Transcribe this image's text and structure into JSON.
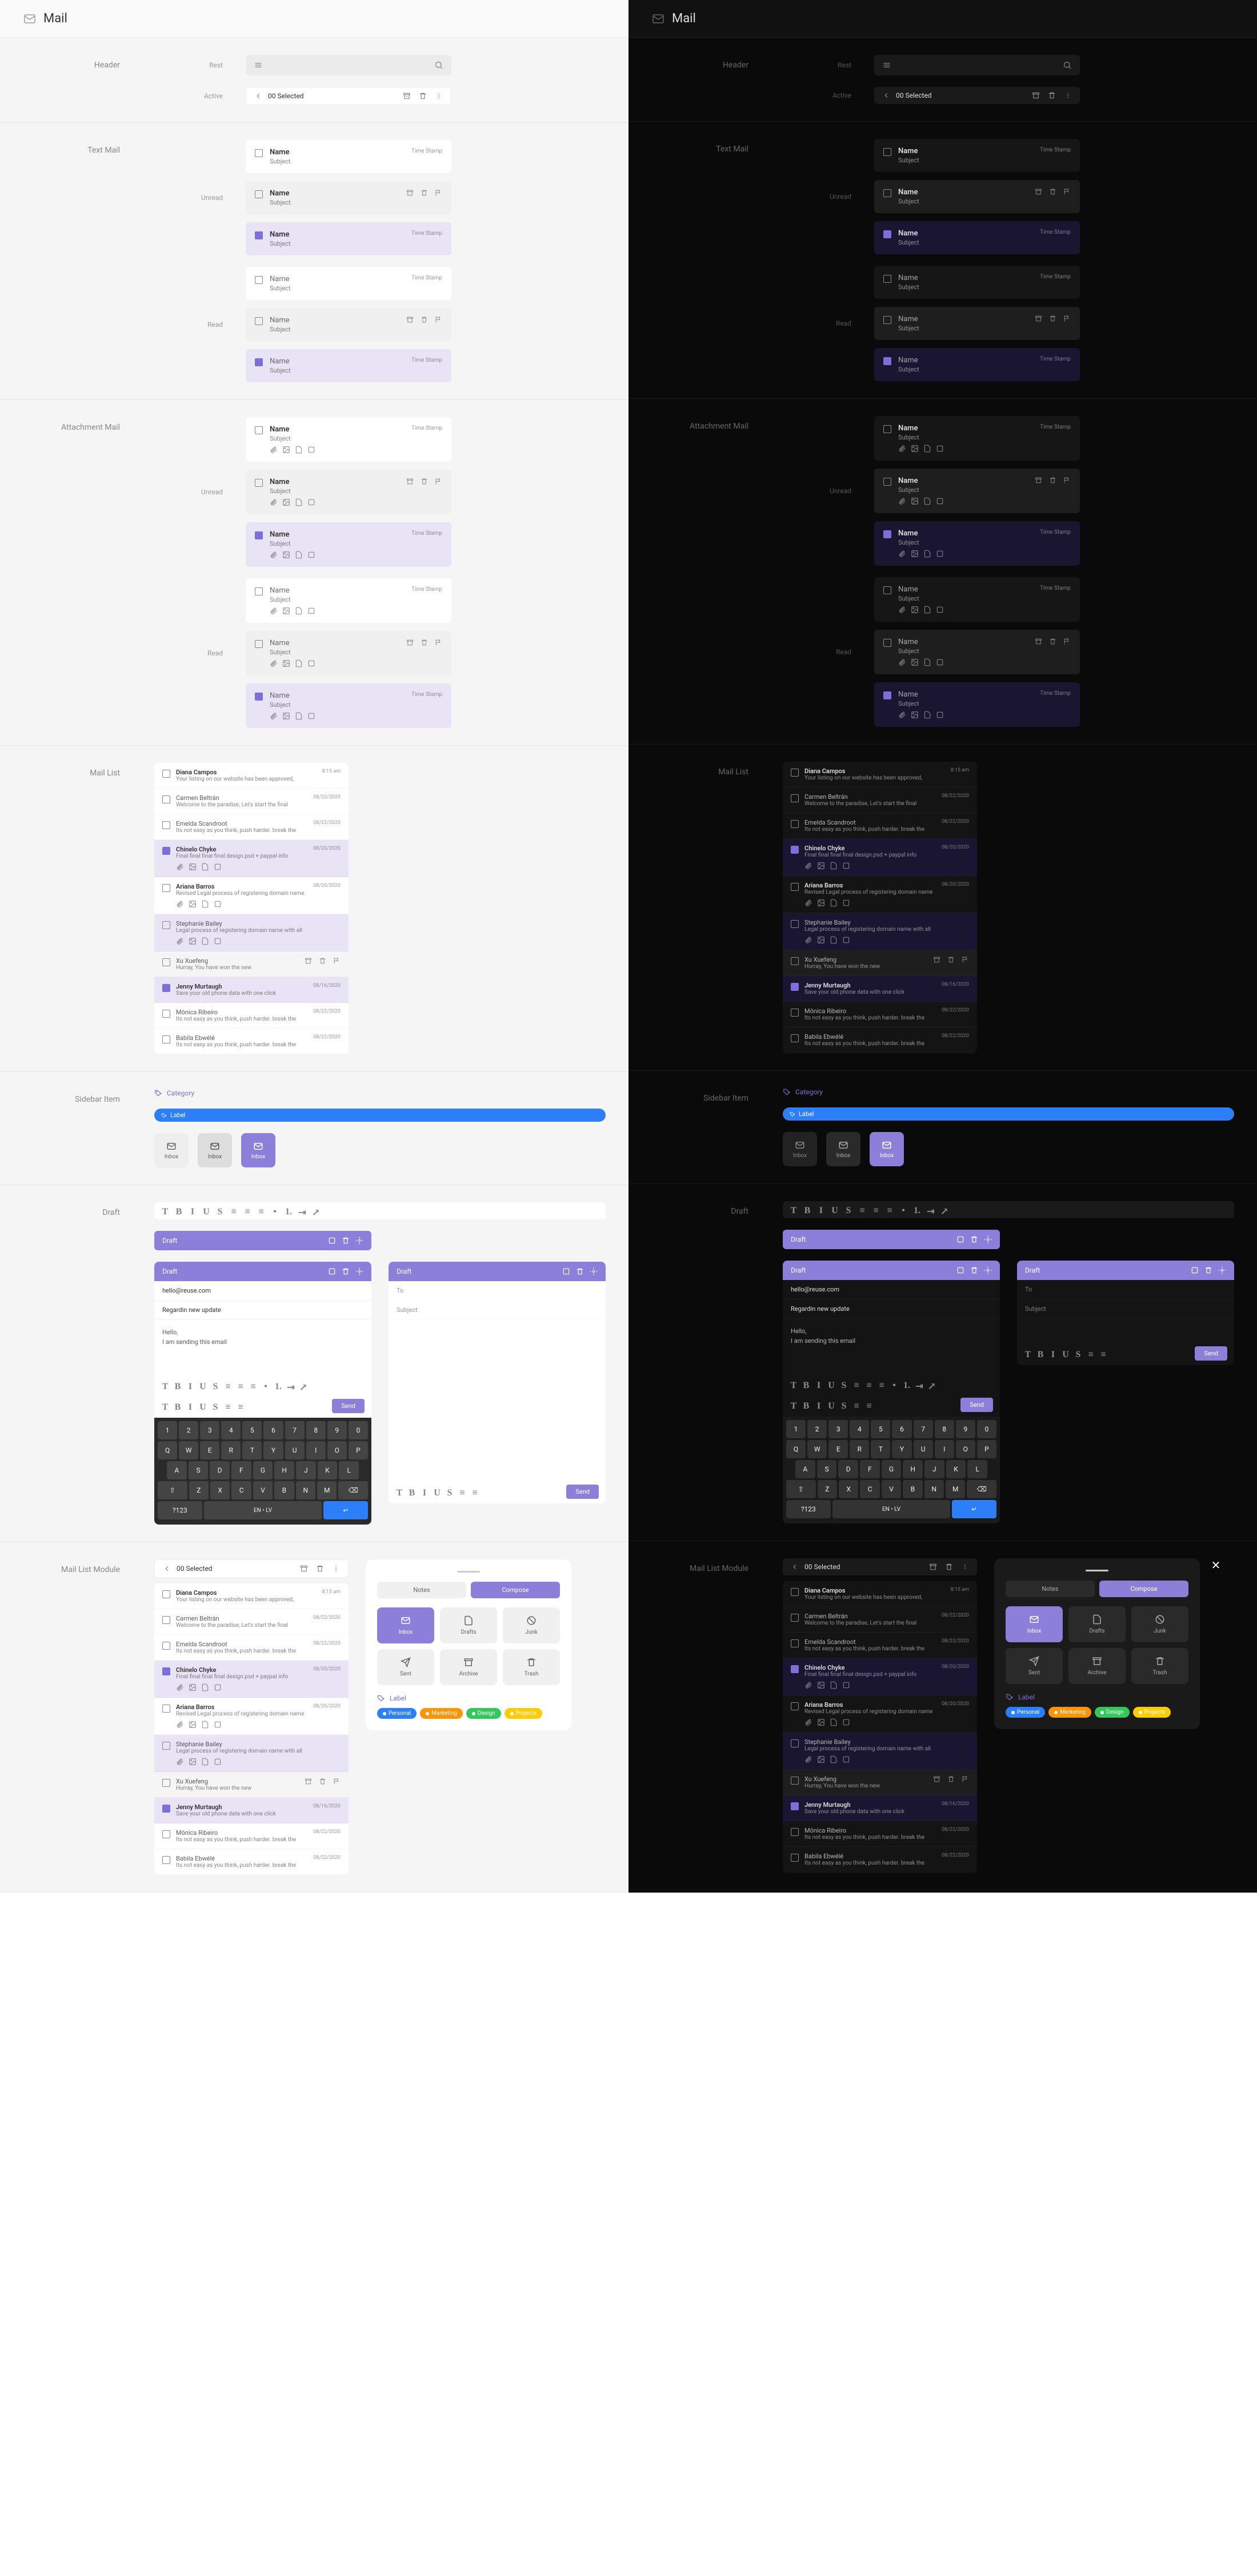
{
  "app_title": "Mail",
  "sections": {
    "header": "Header",
    "text_mail": "Text Mail",
    "attachment_mail": "Attachment Mail",
    "mail_list": "Mail List",
    "sidebar_item": "Sidebar Item",
    "draft": "Draft",
    "mail_list_module": "Mail List Module"
  },
  "states": {
    "rest": "Rest",
    "active": "Active",
    "unread": "Unread",
    "read": "Read"
  },
  "header_bar": {
    "selected_count": "00 Selected"
  },
  "placeholder": {
    "name": "Name",
    "subject": "Subject",
    "timestamp": "Time Stamp"
  },
  "mail_list_data": [
    {
      "name": "Diana Campos",
      "subject": "Your listing on our website has been approved,",
      "time": "8:15 am",
      "unread": true
    },
    {
      "name": "Carmen Beltrán",
      "subject": "Welcome to the paradise, Let's start the final",
      "time": "08/22/2020",
      "unread": false
    },
    {
      "name": "Emelda Scandroot",
      "subject": "Its not easy as you think, push harder. break the",
      "time": "08/22/2020",
      "unread": false
    },
    {
      "name": "Chinelo Chyke",
      "subject": "Final final final final design.psd + paypal info",
      "time": "08/20/2020",
      "unread": true,
      "selected": true,
      "attachments": true
    },
    {
      "name": "Ariana Barros",
      "subject": "Revised Legal process of registering domain name",
      "time": "08/20/2020",
      "unread": true,
      "attachments": true
    },
    {
      "name": "Stephanie Bailey",
      "subject": "Legal process of registering domain name with all",
      "time": "",
      "unread": false,
      "selected_light": true,
      "attachments": true
    },
    {
      "name": "Xu Xuefeng",
      "subject": "Hurray, You have won the new",
      "time": "",
      "unread": false,
      "hover": true,
      "actions": true
    },
    {
      "name": "Jenny Murtaugh",
      "subject": "Save your old phone data with one click",
      "time": "08/16/2020",
      "unread": true,
      "selected": true
    },
    {
      "name": "Mônica Ribeiro",
      "subject": "Its not easy as you think, push harder. break the",
      "time": "08/22/2020",
      "unread": false
    },
    {
      "name": "Babila Ebwélé",
      "subject": "Its not easy as you think, push harder. break the",
      "time": "08/22/2020",
      "unread": false
    }
  ],
  "sidebar": {
    "category": "Category",
    "label": "Label",
    "inbox": "Inbox"
  },
  "draft": {
    "title": "Draft",
    "to_field": "hello@reuse.com",
    "to_placeholder": "To",
    "subject_field": "Regardin new update",
    "subject_placeholder": "Subject",
    "body_greeting": "Hello,",
    "body_line": "I am sending this email",
    "send": "Send"
  },
  "keyboard": {
    "row1": [
      "1",
      "2",
      "3",
      "4",
      "5",
      "6",
      "7",
      "8",
      "9",
      "0"
    ],
    "row2": [
      "Q",
      "W",
      "E",
      "R",
      "T",
      "Y",
      "U",
      "I",
      "O",
      "P"
    ],
    "row3": [
      "A",
      "S",
      "D",
      "F",
      "G",
      "H",
      "J",
      "K",
      "L"
    ],
    "row4_shift": "⇧",
    "row4": [
      "Z",
      "X",
      "C",
      "V",
      "B",
      "N",
      "M"
    ],
    "row4_back": "⌫",
    "mode": "?123",
    "lang": "EN • LV",
    "enter": "↵"
  },
  "module": {
    "notes": "Notes",
    "compose": "Compose",
    "inbox": "Inbox",
    "drafts": "Drafts",
    "junk": "Junk",
    "sent": "Sent",
    "archive": "Archive",
    "trash": "Trash",
    "label_header": "Label",
    "labels": [
      {
        "name": "Personal",
        "color": "#2d7ff9"
      },
      {
        "name": "Marketing",
        "color": "#ff9500"
      },
      {
        "name": "Design",
        "color": "#34c759"
      },
      {
        "name": "Projects",
        "color": "#ffcc00"
      }
    ]
  }
}
